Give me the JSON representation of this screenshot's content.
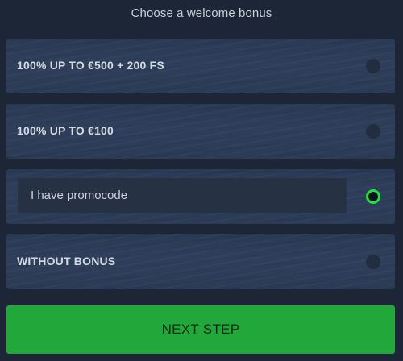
{
  "heading": "Choose a welcome bonus",
  "options": [
    {
      "label": "100% UP TO €500 + 200 FS",
      "selected": false
    },
    {
      "label": "100% UP TO €100",
      "selected": false
    },
    {
      "promo_placeholder": "I have promocode",
      "selected": true
    },
    {
      "label": "WITHOUT BONUS",
      "selected": false
    }
  ],
  "next_button_label": "NEXT STEP",
  "colors": {
    "background": "#1c2636",
    "card": "#2e3d58",
    "accent_green": "#1de53a",
    "button_green": "#22a83a"
  }
}
